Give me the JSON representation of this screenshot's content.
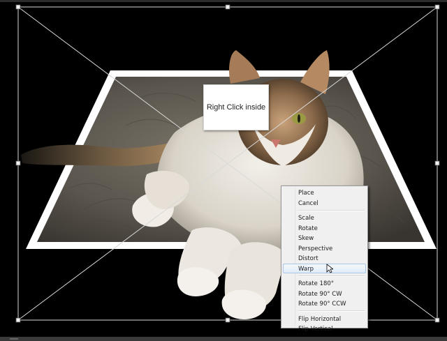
{
  "callout": {
    "text": "Right Click inside"
  },
  "context_menu": {
    "groups": [
      [
        {
          "label": "Place"
        },
        {
          "label": "Cancel"
        }
      ],
      [
        {
          "label": "Scale"
        },
        {
          "label": "Rotate"
        },
        {
          "label": "Skew"
        },
        {
          "label": "Perspective"
        },
        {
          "label": "Distort"
        },
        {
          "label": "Warp",
          "highlighted": true
        }
      ],
      [
        {
          "label": "Rotate 180°"
        },
        {
          "label": "Rotate 90° CW"
        },
        {
          "label": "Rotate 90° CCW"
        }
      ],
      [
        {
          "label": "Flip Horizontal"
        },
        {
          "label": "Flip Vertical"
        }
      ]
    ]
  },
  "colors": {
    "menu_highlight": "#dce8f6",
    "frame": "#ffffff",
    "background": "#000000"
  }
}
